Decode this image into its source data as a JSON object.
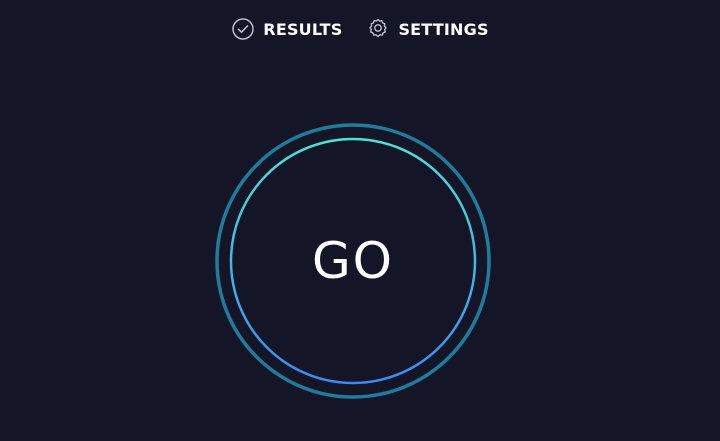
{
  "nav": {
    "results": {
      "label": "RESULTS",
      "icon": "check-circle-icon"
    },
    "settings": {
      "label": "SETTINGS",
      "icon": "gear-icon"
    }
  },
  "start": {
    "label": "GO"
  },
  "colors": {
    "background": "#141526",
    "text": "#ffffff",
    "icon": "#b9bfd0",
    "outer_ring": "#1f7c9d",
    "inner_ring_start": "#4de3d4",
    "inner_ring_end": "#3b8bf2"
  }
}
